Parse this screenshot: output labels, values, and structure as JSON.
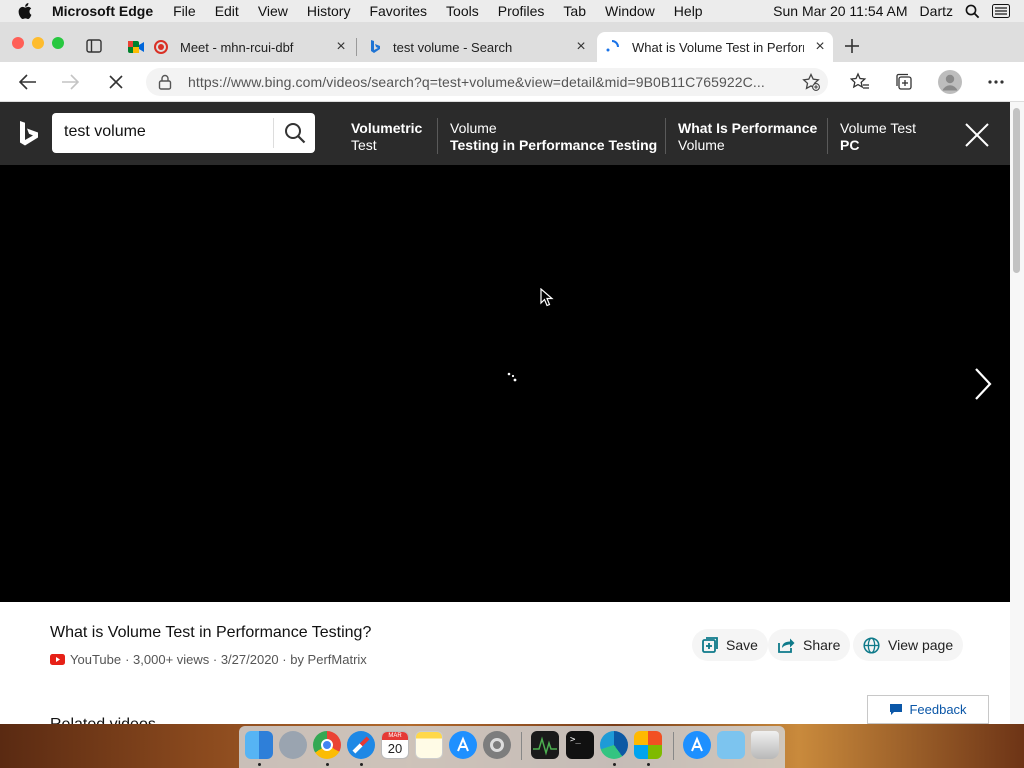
{
  "menubar": {
    "app_name": "Microsoft Edge",
    "items": [
      "File",
      "Edit",
      "View",
      "History",
      "Favorites",
      "Tools",
      "Profiles",
      "Tab",
      "Window",
      "Help"
    ],
    "clock": "Sun Mar 20  11:54 AM",
    "user": "Dartz"
  },
  "tabs": [
    {
      "title": "Meet - mhn-rcui-dbf",
      "icon": "google-meet-icon"
    },
    {
      "title": "test volume - Search",
      "icon": "bing-icon"
    },
    {
      "title": "What is Volume Test in Perform",
      "icon": "loading-icon"
    }
  ],
  "address": {
    "url": "https://www.bing.com/videos/search?q=test+volume&view=detail&mid=9B0B11C765922C..."
  },
  "search": {
    "query": "test volume"
  },
  "related_searches": [
    {
      "line1": "Volumetric",
      "line2": "Test"
    },
    {
      "line1": "Volume",
      "line2": "Testing in Performance Testing"
    },
    {
      "line1": "What Is Performance",
      "line2": "Volume"
    },
    {
      "line1": "Volume Test",
      "line2": "PC"
    }
  ],
  "video": {
    "title": "What is Volume Test in Performance Testing?",
    "source": "YouTube",
    "meta": "· 3,000+ views · 3/27/2020 · by PerfMatrix"
  },
  "actions": {
    "save": "Save",
    "share": "Share",
    "view_page": "View page"
  },
  "feedback": "Feedback",
  "related_heading": "Related videos",
  "dock_calendar": {
    "month": "MAR",
    "day": "20"
  },
  "colors": {
    "bing_header": "#2b2b2b",
    "accent": "#0b57a8",
    "action_icon": "#0e7a8a"
  }
}
